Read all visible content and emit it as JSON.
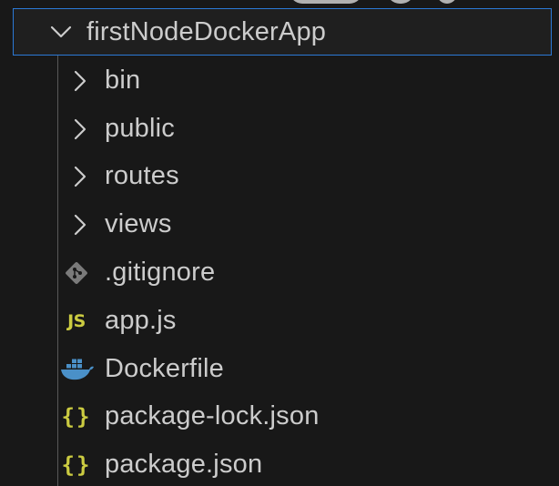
{
  "explorer": {
    "root_folder": {
      "label": "firstNodeDockerApp",
      "expanded": true
    },
    "folders": [
      {
        "label": "bin",
        "expanded": false
      },
      {
        "label": "public",
        "expanded": false
      },
      {
        "label": "routes",
        "expanded": false
      },
      {
        "label": "views",
        "expanded": false
      }
    ],
    "files": [
      {
        "label": ".gitignore",
        "icon": "git-icon"
      },
      {
        "label": "app.js",
        "icon": "js-icon",
        "icon_text": "JS"
      },
      {
        "label": "Dockerfile",
        "icon": "docker-icon"
      },
      {
        "label": "package-lock.json",
        "icon": "json-icon",
        "icon_text": "{}"
      },
      {
        "label": "package.json",
        "icon": "json-icon",
        "icon_text": "{}"
      }
    ]
  },
  "colors": {
    "background": "#181818",
    "text": "#cccccc",
    "selection_border": "#2b79d6",
    "indent_guide": "#585858",
    "js_icon": "#cbcb41",
    "json_icon": "#cbcb41",
    "git_icon": "#7a7a7a",
    "docker_icon": "#4a90c8"
  }
}
